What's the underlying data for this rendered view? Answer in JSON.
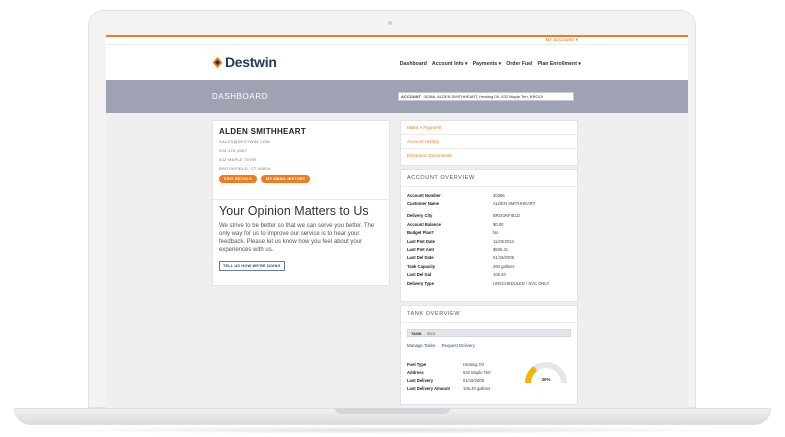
{
  "site": {
    "my_account": "MY ACCOUNT ▾",
    "logo": "Destwin",
    "nav": [
      "Dashboard",
      "Account Info ▾",
      "Payments ▾",
      "Order Fuel",
      "Plan Enrollment ▾"
    ],
    "page_title": "DASHBOARD",
    "account_label": "ACCOUNT",
    "account_value": "30366, ALDEN SMITHHEART, Heating Oil, 632 Maple Terr, BROOI"
  },
  "profile": {
    "name": "ALDEN SMITHHEART",
    "email": "SALES@DESTWIN.COM",
    "phone": "203.123.4567",
    "street": "632 MAPLE TERR",
    "city": "BROOKFIELD, CT 06804",
    "edit_btn": "EDIT DETAILS",
    "email_btn": "MY EMAIL HISTORY"
  },
  "opinion": {
    "title": "Your Opinion Matters to Us",
    "body": "We strive to be better so that we can serve you better. The only way for us to improve our service is to hear your feedback. Please let us know how you feel about your experiences with us.",
    "button": "TELL US HOW WE'RE DOING"
  },
  "quick_links": [
    "Make A Payment",
    "Account History",
    "Electronic Documents"
  ],
  "overview": {
    "heading": "ACCOUNT OVERVIEW",
    "rows1": [
      {
        "k": "Account Number",
        "v": "30366"
      },
      {
        "k": "Customer Name",
        "v": "ALDEN SMITHHEART"
      }
    ],
    "rows2": [
      {
        "k": "Delivery City",
        "v": "BROOKFIELD"
      },
      {
        "k": "Account Balance",
        "v": "$0.00"
      },
      {
        "k": "Budget Plan?",
        "v": "No"
      },
      {
        "k": "Last Pmt Date",
        "v": "11/20/2013"
      },
      {
        "k": "Last Pmt Amt",
        "v": "$536.41"
      },
      {
        "k": "Last Del Date",
        "v": "01/19/2009"
      },
      {
        "k": "Tank Capacity",
        "v": "260 gallons"
      },
      {
        "k": "Last Del Gal",
        "v": "106.40"
      },
      {
        "k": "Delivery Type",
        "v": "UNSCHEDULED / SVC ONLY"
      }
    ]
  },
  "tank": {
    "heading": "TANK OVERVIEW",
    "select_label": "TANK",
    "select_value": "0001",
    "links": [
      "Manage Tanks",
      "Request Delivery"
    ],
    "rows": [
      {
        "k": "Fuel Type",
        "v": "Heating Oil"
      },
      {
        "k": "Address",
        "v": "632 Maple Terr"
      },
      {
        "k": "Last Delivery",
        "v": "01/19/2009"
      },
      {
        "k": "Last Delivery Amount",
        "v": "106.40 gallons"
      }
    ],
    "gauge_percent": 30,
    "gauge_label": "30%",
    "gauge_color": "#f5b400"
  }
}
